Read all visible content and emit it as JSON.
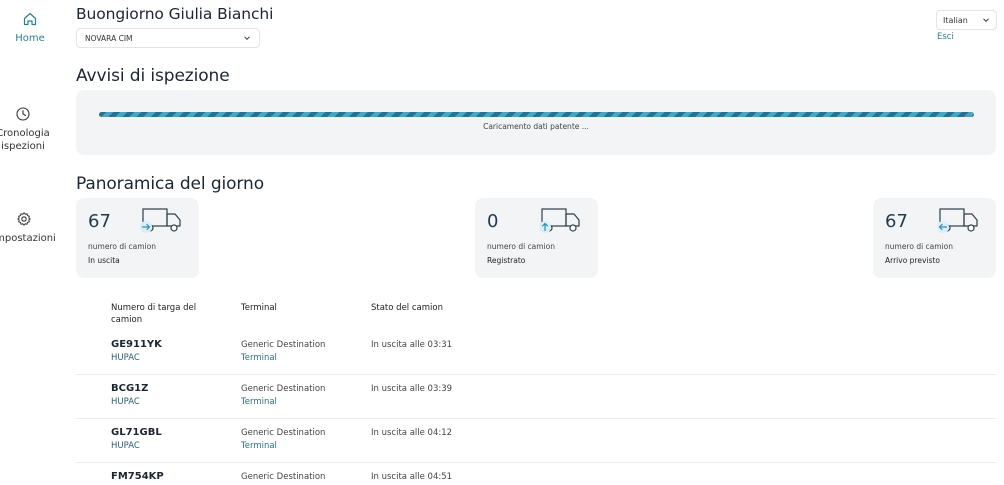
{
  "sidebar": {
    "items": [
      {
        "label": "Home",
        "icon": "home-icon"
      },
      {
        "label": "Cronologia\nispezioni",
        "line1": "Cronologia",
        "line2": "ispezioni",
        "icon": "clock-icon"
      },
      {
        "label": "Impostazioni",
        "icon": "gear-icon"
      }
    ]
  },
  "header": {
    "greeting": "Buongiorno Giulia Bianchi",
    "site_selected": "NOVARA CIM",
    "language_selected": "Italian",
    "logout_label": "Esci"
  },
  "alerts": {
    "title": "Avvisi di ispezione",
    "loading_text": "Caricamento dati patente ..."
  },
  "overview": {
    "title": "Panoramica del giorno",
    "cards": [
      {
        "value": "67",
        "caption": "numero di camion",
        "label": "In uscita",
        "icon": "truck-outgoing-icon"
      },
      {
        "value": "0",
        "caption": "numero di camion",
        "label": "Registrato",
        "icon": "truck-registered-icon"
      },
      {
        "value": "67",
        "caption": "numero di camion",
        "label": "Arrivo previsto",
        "icon": "truck-incoming-icon"
      }
    ]
  },
  "table": {
    "headers": {
      "plate_line1": "Numero di targa del",
      "plate_line2": "camion",
      "terminal": "Terminal",
      "status": "Stato del camion"
    },
    "rows": [
      {
        "plate": "GE911YK",
        "operator": "HUPAC",
        "destination": "Generic Destination",
        "destination_sub": "Terminal",
        "status": "In uscita alle 03:31"
      },
      {
        "plate": "BCG1Z",
        "operator": "HUPAC",
        "destination": "Generic Destination",
        "destination_sub": "Terminal",
        "status": "In uscita alle 03:39"
      },
      {
        "plate": "GL71GBL",
        "operator": "HUPAC",
        "destination": "Generic Destination",
        "destination_sub": "Terminal",
        "status": "In uscita alle 04:12"
      },
      {
        "plate": "FM754KP",
        "operator": "",
        "destination": "Generic Destination",
        "destination_sub": "",
        "status": "In uscita alle 04:51"
      }
    ]
  },
  "colors": {
    "accent": "#2d7f8d",
    "panel": "#f3f4f5",
    "truck_badge": "#d9eef6",
    "truck_arrow": "#2a8fb8"
  }
}
